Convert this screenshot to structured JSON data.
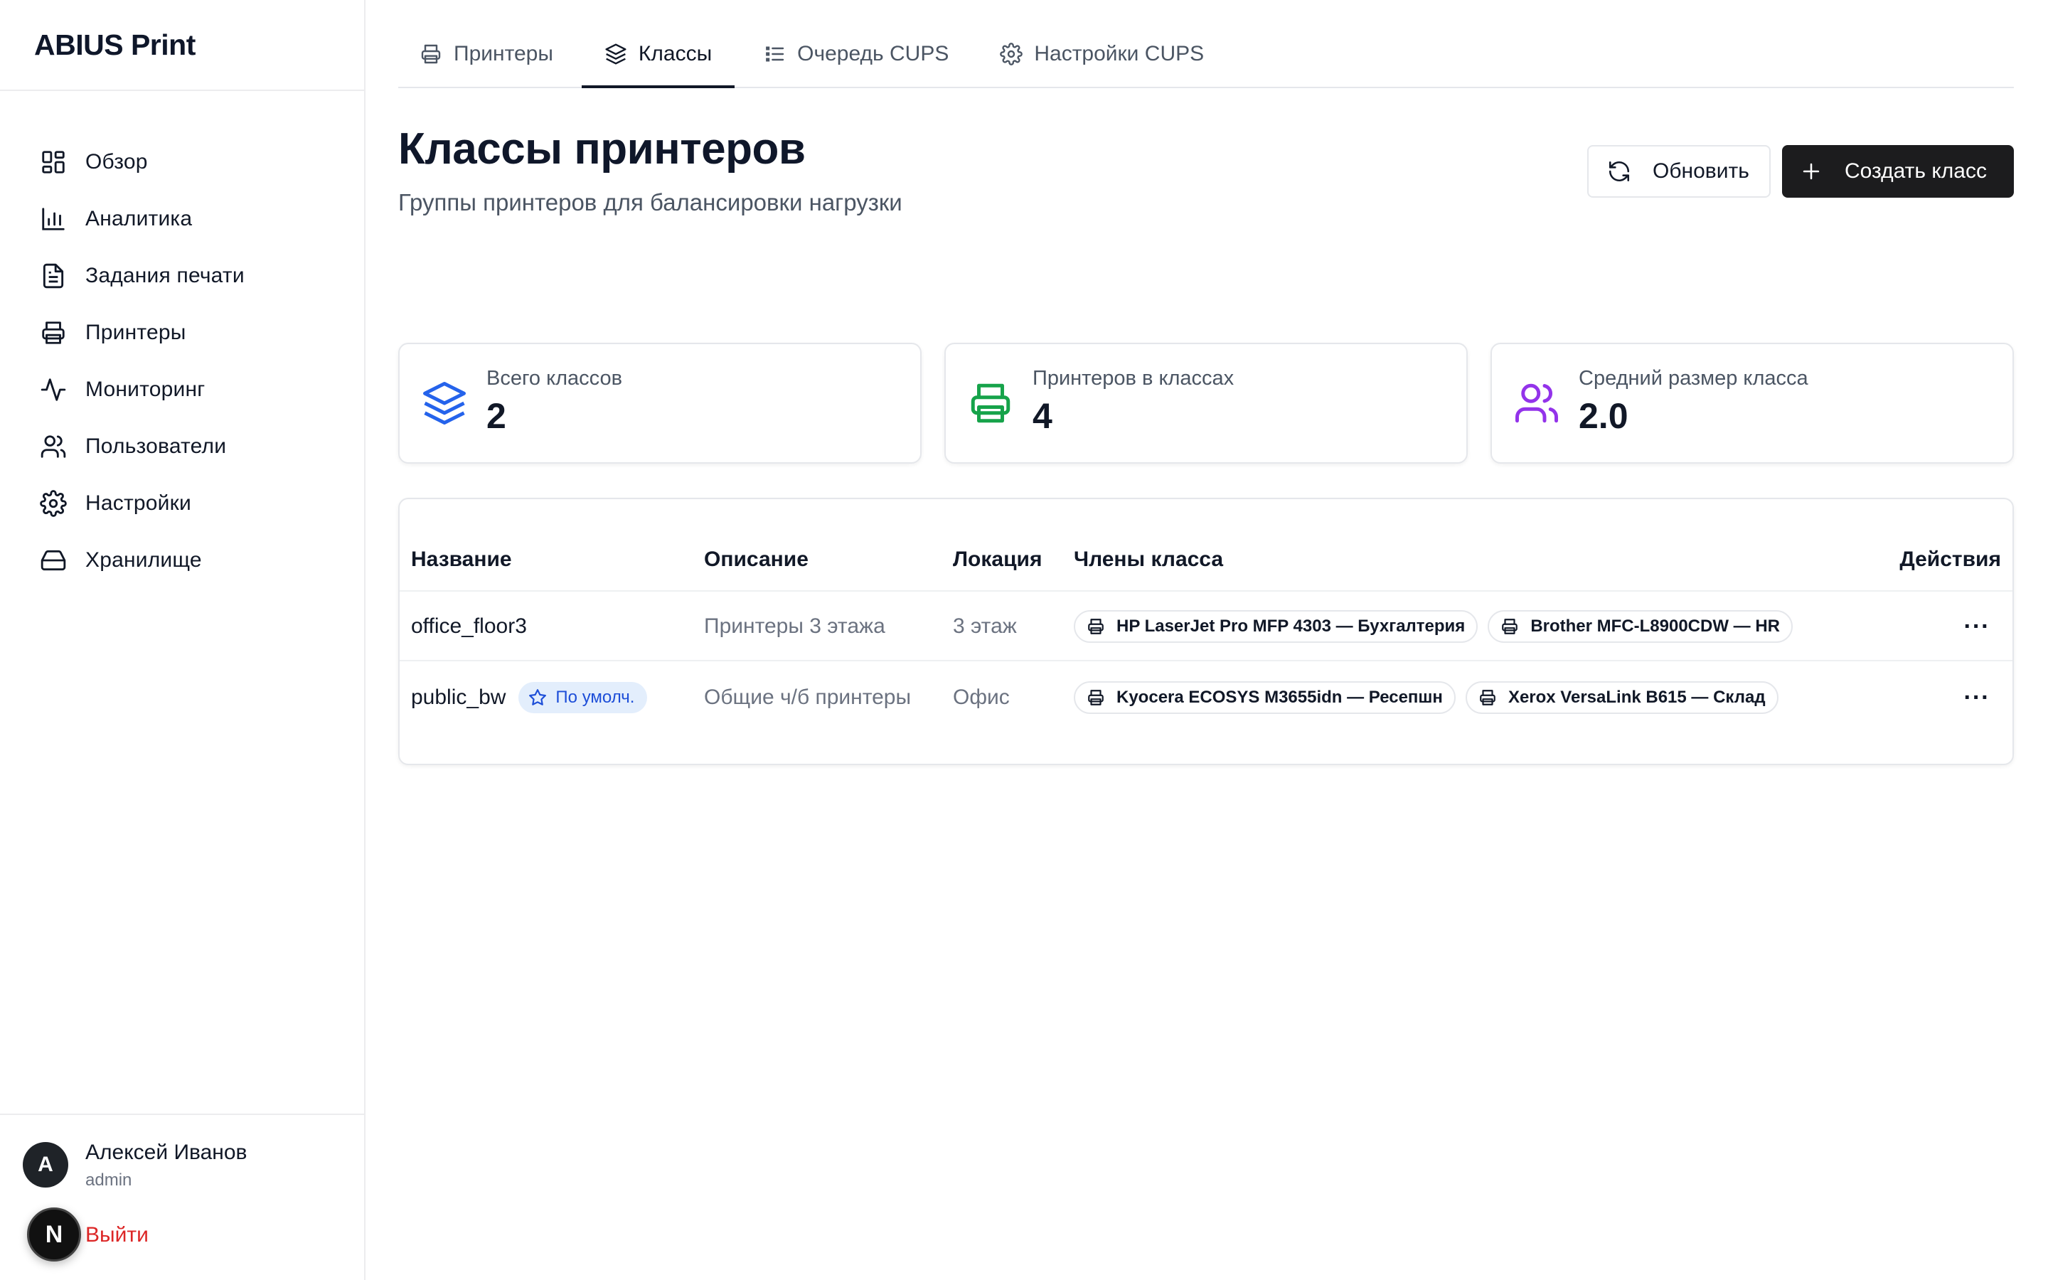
{
  "app": {
    "title": "ABIUS Print"
  },
  "sidebar": {
    "items": [
      {
        "label": "Обзор",
        "icon": "dashboard-icon"
      },
      {
        "label": "Аналитика",
        "icon": "bar-chart-icon"
      },
      {
        "label": "Задания печати",
        "icon": "document-icon"
      },
      {
        "label": "Принтеры",
        "icon": "printer-icon"
      },
      {
        "label": "Мониторинг",
        "icon": "activity-icon"
      },
      {
        "label": "Пользователи",
        "icon": "users-icon"
      },
      {
        "label": "Настройки",
        "icon": "gear-icon"
      },
      {
        "label": "Хранилище",
        "icon": "hard-drive-icon"
      }
    ]
  },
  "user": {
    "initial": "A",
    "name": "Алексей Иванов",
    "role": "admin",
    "logout": "Выйти",
    "next_badge": "N"
  },
  "tabs": [
    {
      "label": "Принтеры",
      "icon": "printer-icon",
      "active": false
    },
    {
      "label": "Классы",
      "icon": "layers-icon",
      "active": true
    },
    {
      "label": "Очередь CUPS",
      "icon": "list-icon",
      "active": false
    },
    {
      "label": "Настройки CUPS",
      "icon": "gear-icon",
      "active": false
    }
  ],
  "header": {
    "title": "Классы принтеров",
    "subtitle": "Группы принтеров для балансировки нагрузки",
    "refresh_label": "Обновить",
    "create_label": "Создать класс"
  },
  "stats": [
    {
      "label": "Всего классов",
      "value": "2",
      "icon": "layers-icon",
      "color": "#2563eb"
    },
    {
      "label": "Принтеров в классах",
      "value": "4",
      "icon": "printer-icon",
      "color": "#16a34a"
    },
    {
      "label": "Средний размер класса",
      "value": "2.0",
      "icon": "users-icon",
      "color": "#9333ea"
    }
  ],
  "table": {
    "columns": {
      "name": "Название",
      "description": "Описание",
      "location": "Локация",
      "members": "Члены класса",
      "actions": "Действия"
    },
    "rows": [
      {
        "name": "office_floor3",
        "default_badge": "",
        "description": "Принтеры 3 этажа",
        "location": "3 этаж",
        "members": [
          "HP LaserJet Pro MFP 4303 — Бухгалтерия",
          "Brother MFC-L8900CDW — HR"
        ],
        "actions": "···"
      },
      {
        "name": "public_bw",
        "default_badge": "По умолч.",
        "description": "Общие ч/б принтеры",
        "location": "Офис",
        "members": [
          "Kyocera ECOSYS M3655idn — Ресепшн",
          "Xerox VersaLink B615 — Склад"
        ],
        "actions": "···"
      }
    ]
  },
  "colors": {
    "accent_dark": "#1c1c1e",
    "danger": "#dc2626",
    "badge_bg": "#e3eefc",
    "badge_text": "#1d4ed8"
  }
}
